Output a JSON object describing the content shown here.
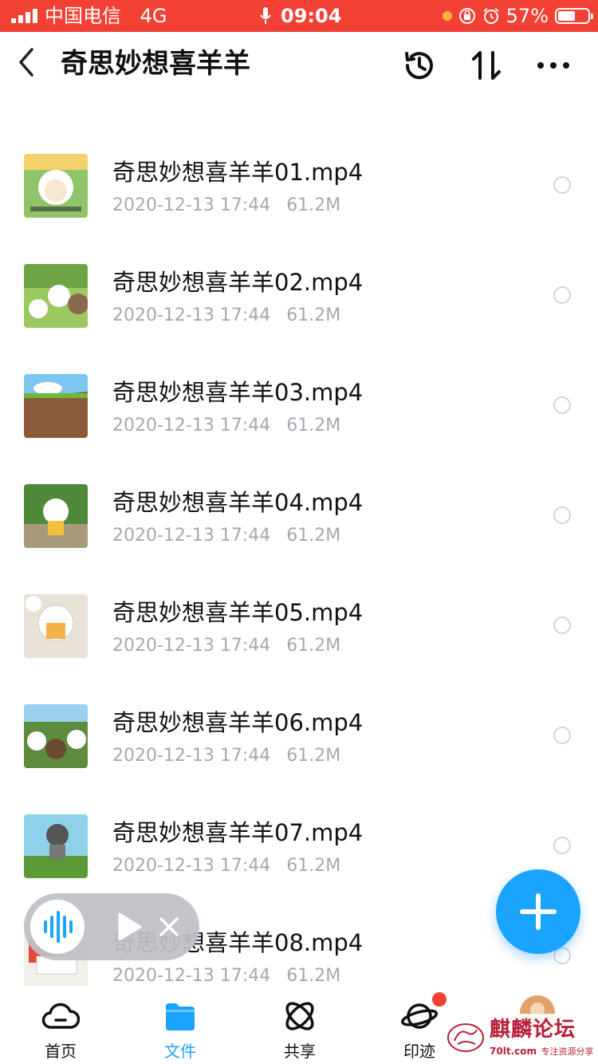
{
  "status_bar": {
    "carrier": "中国电信",
    "network": "4G",
    "time": "09:04",
    "battery": "57%",
    "battery_level": 0.57
  },
  "header": {
    "title": "奇思妙想喜羊羊"
  },
  "files": [
    {
      "name": "奇思妙想喜羊羊01.mp4",
      "date": "2020-12-13 17:44",
      "size": "61.2M"
    },
    {
      "name": "奇思妙想喜羊羊02.mp4",
      "date": "2020-12-13 17:44",
      "size": "61.2M"
    },
    {
      "name": "奇思妙想喜羊羊03.mp4",
      "date": "2020-12-13 17:44",
      "size": "61.2M"
    },
    {
      "name": "奇思妙想喜羊羊04.mp4",
      "date": "2020-12-13 17:44",
      "size": "61.2M"
    },
    {
      "name": "奇思妙想喜羊羊05.mp4",
      "date": "2020-12-13 17:44",
      "size": "61.2M"
    },
    {
      "name": "奇思妙想喜羊羊06.mp4",
      "date": "2020-12-13 17:44",
      "size": "61.2M"
    },
    {
      "name": "奇思妙想喜羊羊07.mp4",
      "date": "2020-12-13 17:44",
      "size": "61.2M"
    },
    {
      "name": "奇思妙想喜羊羊08.mp4",
      "date": "2020-12-13 17:44",
      "size": "61.2M"
    }
  ],
  "tabs": [
    {
      "label": "首页",
      "icon": "cloud-icon"
    },
    {
      "label": "文件",
      "icon": "folder-icon",
      "active": true
    },
    {
      "label": "共享",
      "icon": "share-orbit-icon"
    },
    {
      "label": "印迹",
      "icon": "planet-icon"
    }
  ],
  "watermark": {
    "title": "麒麟论坛",
    "site": "70lt.com",
    "slogan": "专注资源分享"
  },
  "colors": {
    "status_bar": "#f24134",
    "accent": "#1aa4ff",
    "meta_text": "#a4a8b0"
  }
}
